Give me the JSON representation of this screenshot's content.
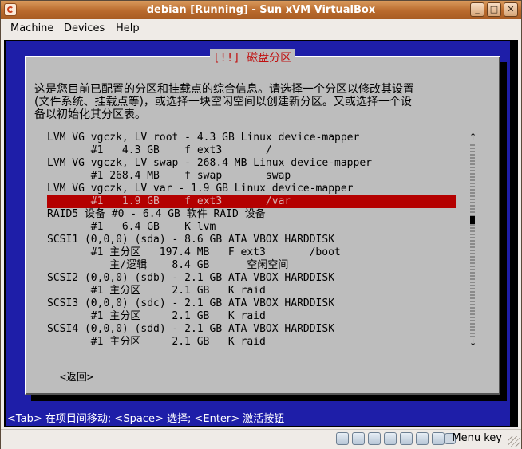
{
  "window": {
    "title": "debian [Running] - Sun xVM VirtualBox",
    "controls": [
      "_",
      "□",
      "✕"
    ]
  },
  "menubar": {
    "items": [
      {
        "label": "Machine"
      },
      {
        "label": "Devices"
      },
      {
        "label": "Help"
      }
    ]
  },
  "installer": {
    "dialog_title": "[!!] 磁盘分区",
    "intro_lines": [
      "这是您目前已配置的分区和挂载点的综合信息。请选择一个分区以修改其设置",
      "(文件系统、挂载点等)，或选择一块空闲空间以创建新分区。又或选择一个设",
      "备以初始化其分区表。"
    ],
    "partition_rows": [
      "LVM VG vgczk, LV root - 4.3 GB Linux device-mapper",
      "       #1   4.3 GB    f ext3       /",
      "LVM VG vgczk, LV swap - 268.4 MB Linux device-mapper",
      "       #1 268.4 MB    f swap       swap",
      "LVM VG vgczk, LV var - 1.9 GB Linux device-mapper",
      "       #1   1.9 GB    f ext3       /var",
      "RAID5 设备 #0 - 6.4 GB 软件 RAID 设备",
      "       #1   6.4 GB    K lvm",
      "SCSI1 (0,0,0) (sda) - 8.6 GB ATA VBOX HARDDISK",
      "       #1 主分区   197.4 MB   F ext3       /boot",
      "          主/逻辑    8.4 GB      空闲空间",
      "SCSI2 (0,0,0) (sdb) - 2.1 GB ATA VBOX HARDDISK",
      "       #1 主分区     2.1 GB   K raid",
      "SCSI3 (0,0,0) (sdc) - 2.1 GB ATA VBOX HARDDISK",
      "       #1 主分区     2.1 GB   K raid",
      "SCSI4 (0,0,0) (sdd) - 2.1 GB ATA VBOX HARDDISK",
      "       #1 主分区     2.1 GB   K raid"
    ],
    "selected_row_index": 5,
    "scroll_up": "↑",
    "scroll_down": "↓",
    "back_button": "<返回>",
    "hint_line": "<Tab> 在项目间移动; <Space> 选择; <Enter> 激活按钮"
  },
  "statusbar": {
    "host_key_label": "Menu key"
  },
  "colors": {
    "tui_background": "#1e1ea8",
    "dialog_background": "#bdbdbd",
    "selection": "#b40000",
    "title_text": "#c01010"
  }
}
